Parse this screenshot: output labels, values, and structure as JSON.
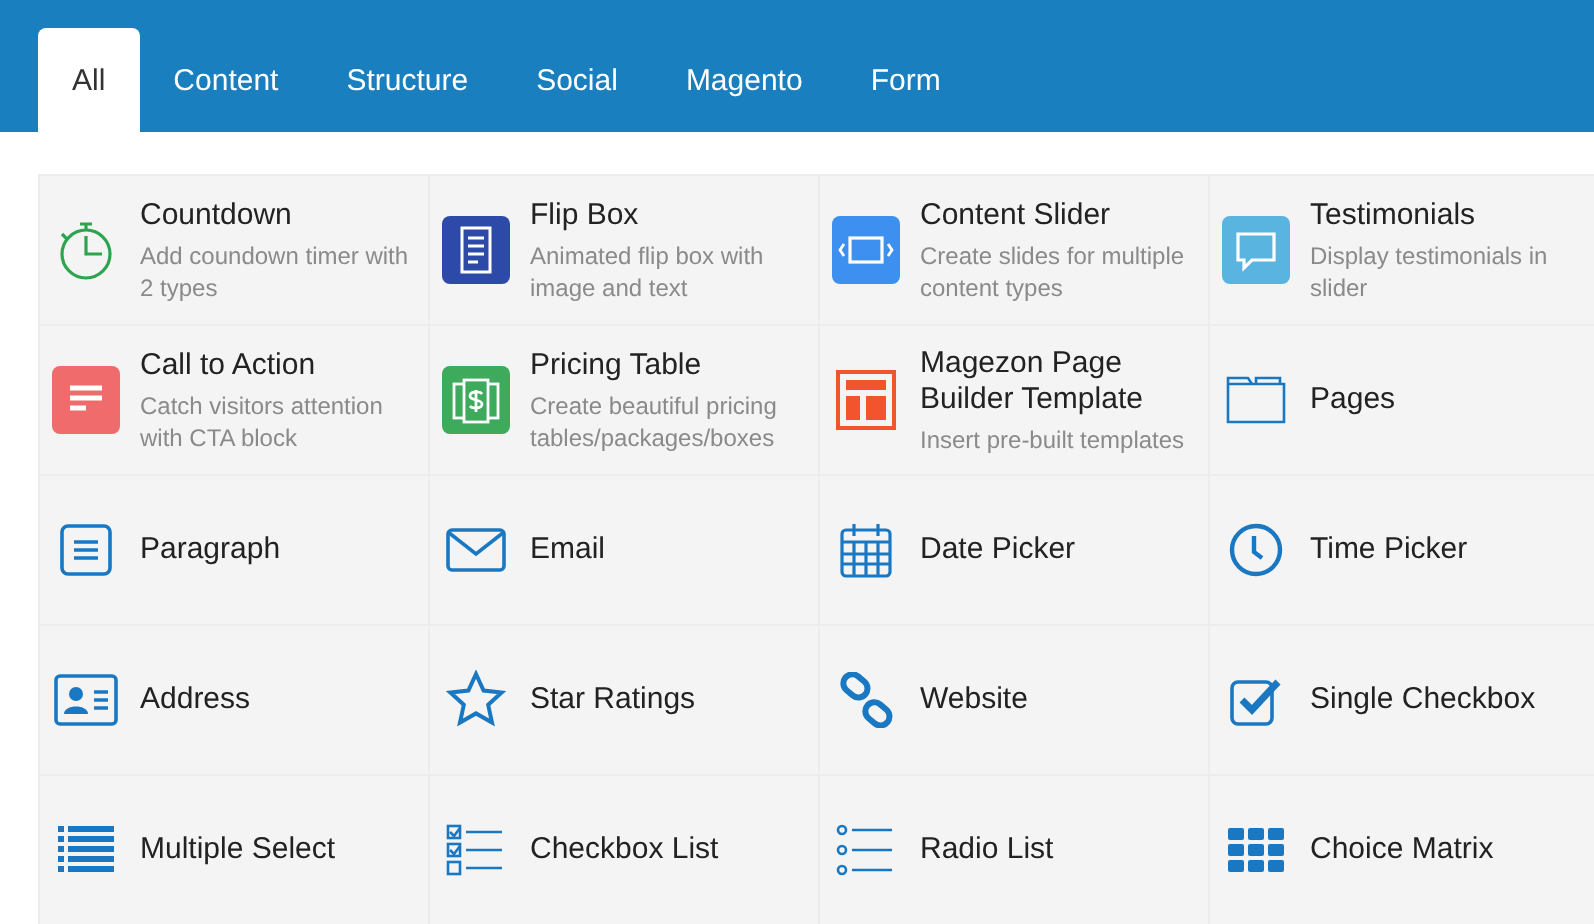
{
  "tabs": [
    {
      "label": "All",
      "selected": true
    },
    {
      "label": "Content",
      "selected": false
    },
    {
      "label": "Structure",
      "selected": false
    },
    {
      "label": "Social",
      "selected": false
    },
    {
      "label": "Magento",
      "selected": false
    },
    {
      "label": "Form",
      "selected": false
    }
  ],
  "elements": [
    {
      "title": "Countdown",
      "description": "Add coundown timer with 2 types"
    },
    {
      "title": "Flip Box",
      "description": "Animated flip box with image and text"
    },
    {
      "title": "Content Slider",
      "description": "Create slides for multiple content types"
    },
    {
      "title": "Testimonials",
      "description": "Display testimonials in slider"
    },
    {
      "title": "Call to Action",
      "description": "Catch visitors attention with CTA block"
    },
    {
      "title": "Pricing Table",
      "description": "Create beautiful pricing tables/packages/boxes"
    },
    {
      "title": "Magezon Page Builder Template",
      "description": "Insert pre-built templates"
    },
    {
      "title": "Pages"
    },
    {
      "title": "Paragraph"
    },
    {
      "title": "Email"
    },
    {
      "title": "Date Picker"
    },
    {
      "title": "Time Picker"
    },
    {
      "title": "Address"
    },
    {
      "title": "Star Ratings"
    },
    {
      "title": "Website"
    },
    {
      "title": "Single Checkbox"
    },
    {
      "title": "Multiple Select"
    },
    {
      "title": "Checkbox List"
    },
    {
      "title": "Radio List"
    },
    {
      "title": "Choice Matrix"
    }
  ]
}
